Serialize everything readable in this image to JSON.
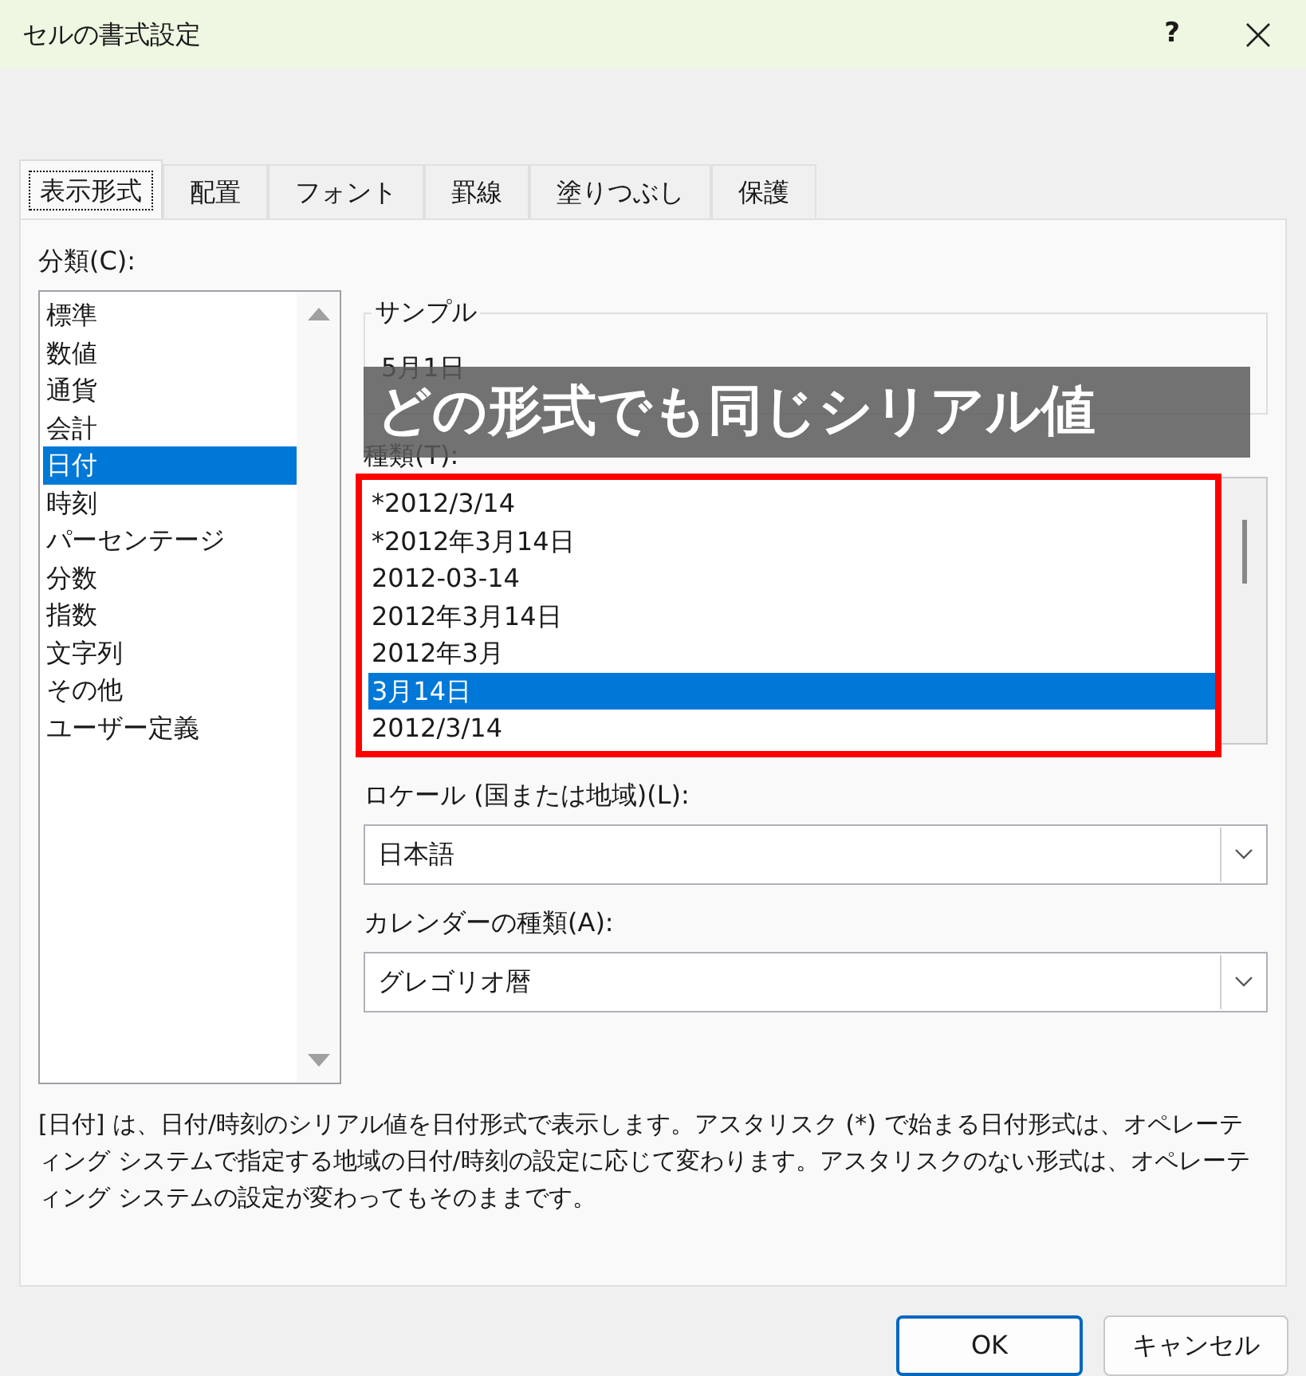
{
  "window": {
    "title": "セルの書式設定",
    "help": "?"
  },
  "tabs": [
    {
      "label": "表示形式",
      "selected": true
    },
    {
      "label": "配置",
      "selected": false
    },
    {
      "label": "フォント",
      "selected": false
    },
    {
      "label": "罫線",
      "selected": false
    },
    {
      "label": "塗りつぶし",
      "selected": false
    },
    {
      "label": "保護",
      "selected": false
    }
  ],
  "category": {
    "label": "分類(C):",
    "items": [
      {
        "label": "標準",
        "selected": false
      },
      {
        "label": "数値",
        "selected": false
      },
      {
        "label": "通貨",
        "selected": false
      },
      {
        "label": "会計",
        "selected": false
      },
      {
        "label": "日付",
        "selected": true
      },
      {
        "label": "時刻",
        "selected": false
      },
      {
        "label": "パーセンテージ",
        "selected": false
      },
      {
        "label": "分数",
        "selected": false
      },
      {
        "label": "指数",
        "selected": false
      },
      {
        "label": "文字列",
        "selected": false
      },
      {
        "label": "その他",
        "selected": false
      },
      {
        "label": "ユーザー定義",
        "selected": false
      }
    ]
  },
  "sample": {
    "label": "サンプル",
    "value": "5月1日"
  },
  "type": {
    "label": "種類(T):",
    "items": [
      {
        "label": "*2012/3/14",
        "selected": false
      },
      {
        "label": "*2012年3月14日",
        "selected": false
      },
      {
        "label": "2012-03-14",
        "selected": false
      },
      {
        "label": "2012年3月14日",
        "selected": false
      },
      {
        "label": "2012年3月",
        "selected": false
      },
      {
        "label": "3月14日",
        "selected": true
      },
      {
        "label": "2012/3/14",
        "selected": false
      }
    ]
  },
  "locale": {
    "label": "ロケール (国または地域)(L):",
    "value": "日本語"
  },
  "calendar": {
    "label": "カレンダーの種類(A):",
    "value": "グレゴリオ暦"
  },
  "description": "[日付] は、日付/時刻のシリアル値を日付形式で表示します。アスタリスク (*) で始まる日付形式は、オペレーティング システムで指定する地域の日付/時刻の設定に応じて変わります。アスタリスクのない形式は、オペレーティング システムの設定が変わってもそのままです。",
  "annotation": {
    "text": "どの形式でも同じシリアル値"
  },
  "buttons": [
    {
      "label": "OK",
      "kind": "primary"
    },
    {
      "label": "キャンセル",
      "kind": "secondary"
    }
  ]
}
